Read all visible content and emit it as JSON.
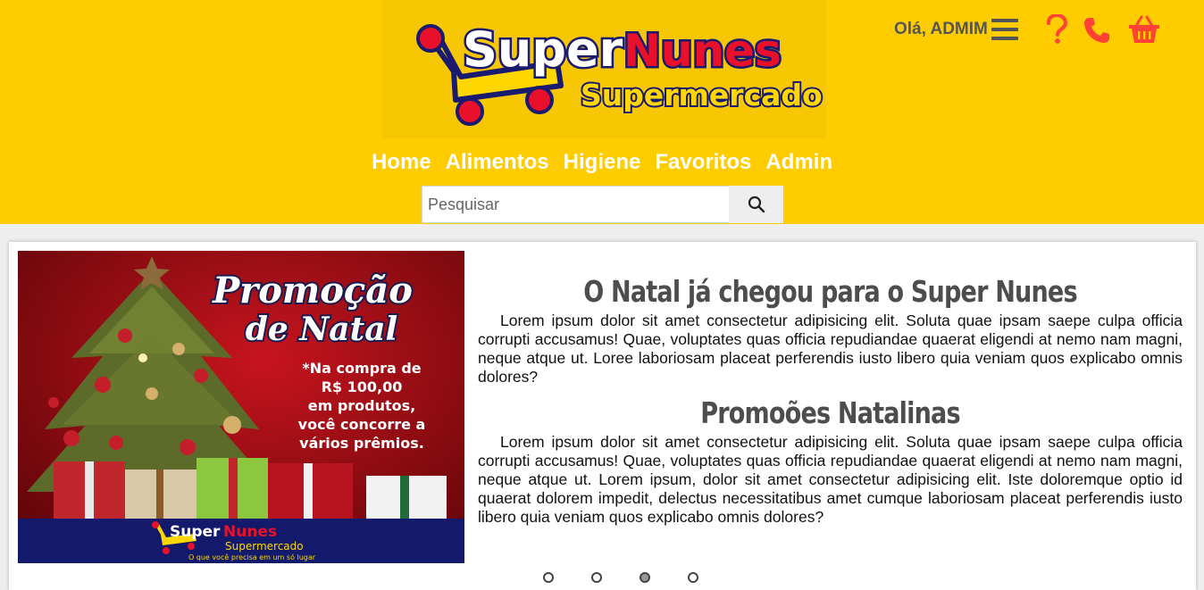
{
  "header": {
    "logo": {
      "brand_first": "Super",
      "brand_second": "Nunes",
      "tagline": "Supermercado"
    },
    "greeting": "Olá, ADMIM",
    "icons": [
      "menu-icon",
      "help-icon",
      "phone-icon",
      "basket-icon"
    ],
    "colors": {
      "background": "#ffcc00",
      "accent": "#ff4136",
      "text": "#555555"
    }
  },
  "nav": {
    "items": [
      {
        "label": "Home"
      },
      {
        "label": "Alimentos"
      },
      {
        "label": "Higiene"
      },
      {
        "label": "Favoritos"
      },
      {
        "label": "Admin"
      }
    ]
  },
  "search": {
    "placeholder": "Pesquisar"
  },
  "banner": {
    "title_line1": "Promoção",
    "title_line2": "de Natal",
    "body": [
      "*Na compra de",
      "R$ 100,00",
      "em produtos,",
      "você concorre a",
      "vários prêmios."
    ],
    "brand_first": "Super",
    "brand_second": "Nunes",
    "brand_sub": "Supermercado",
    "slogan": "O que você precisa em um só lugar"
  },
  "content": {
    "heading1": "O Natal já chegou para o Super Nunes",
    "paragraph1": "Lorem ipsum dolor sit amet consectetur adipisicing elit. Soluta quae ipsam saepe culpa officia corrupti accusamus! Quae, voluptates quas officia repudiandae quaerat eligendi at nemo nam magni, neque atque ut. Loree laboriosam placeat perferendis iusto libero quia veniam quos explicabo omnis dolores?",
    "heading2": "Promoões Natalinas",
    "paragraph2": "Lorem ipsum dolor sit amet consectetur adipisicing elit. Soluta quae ipsam saepe culpa officia corrupti accusamus! Quae, voluptates quas officia repudiandae quaerat eligendi at nemo nam magni, neque atque ut. Lorem ipsum, dolor sit amet consectetur adipisicing elit. Iste doloremque optio id quaerat dolorem impedit, delectus necessitatibus amet cumque laboriosam placeat perferendis iusto libero quia veniam quos explicabo omnis dolores?"
  },
  "carousel": {
    "slide_count": 4,
    "active_index": 2
  }
}
